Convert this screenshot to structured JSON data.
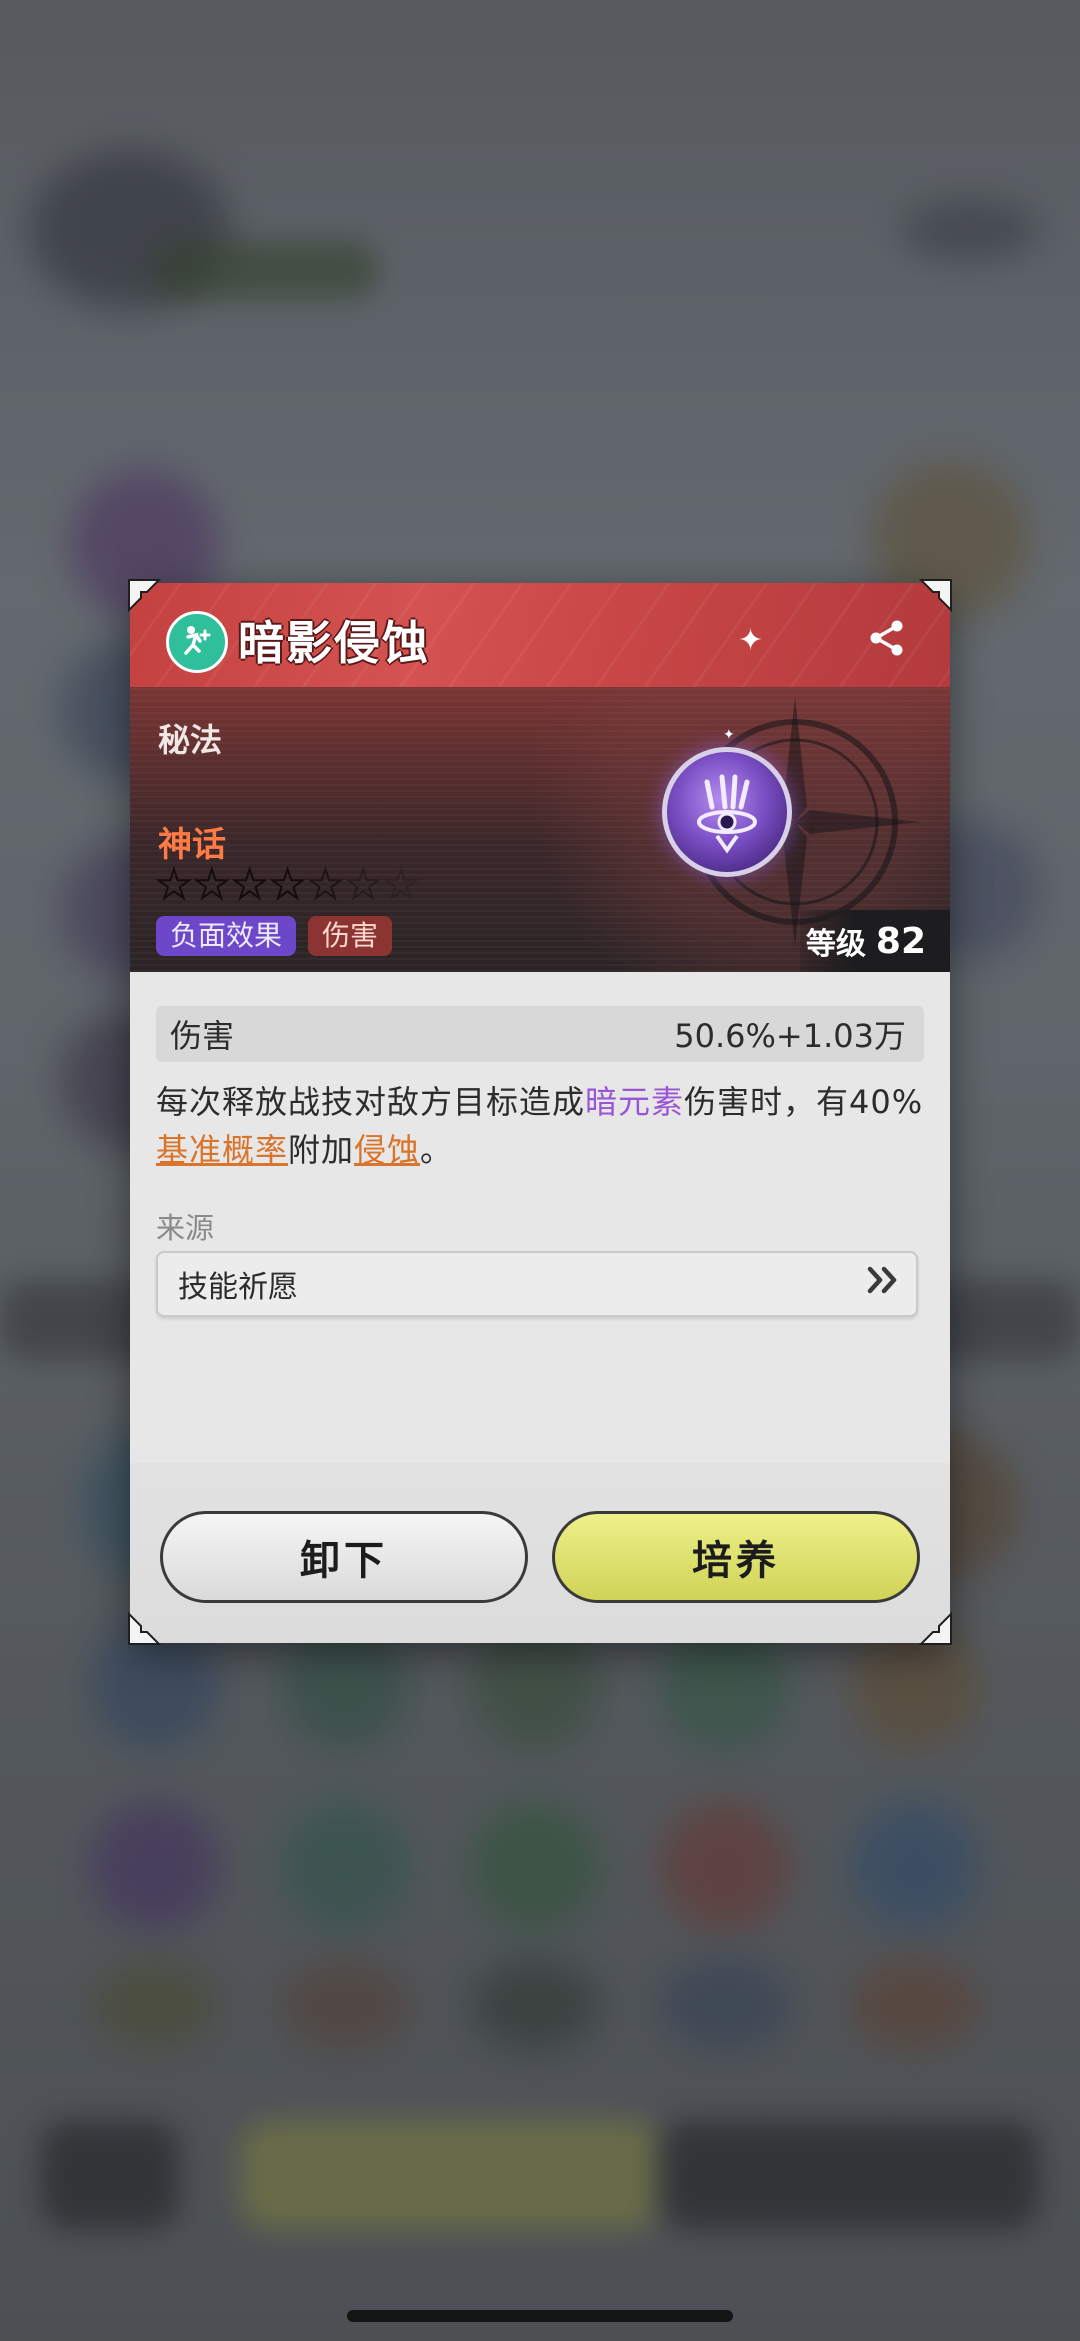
{
  "popup": {
    "title": "暗影侵蚀",
    "type_icon": "running-figure-icon",
    "category": "秘法",
    "rarity": "神话",
    "stars_total": 7,
    "stars_filled": 0,
    "tags": [
      "负面效果",
      "伤害"
    ],
    "level_label": "等级",
    "level_value": "82",
    "skill_icon": "dark-element-sigil-icon",
    "share_icon": "share-icon",
    "stat": {
      "label": "伤害",
      "value": "50.6%+1.03万"
    },
    "description": {
      "part1": "每次释放战技对敌方目标造成",
      "element": "暗元素",
      "part2": "伤害时，有40%",
      "link1": "基准概率",
      "part3": "附加",
      "link2": "侵蚀",
      "part4": "。"
    },
    "source_label": "来源",
    "source_value": "技能祈愿",
    "buttons": {
      "unequip": "卸下",
      "train": "培养"
    }
  },
  "colors": {
    "header_red": "#c84646",
    "rarity_orange": "#ff7b45",
    "tag_purple": "#6c47c8",
    "tag_red": "#8c3432",
    "highlight_purple": "#9a55d6",
    "highlight_orange": "#d9742a",
    "train_button": "#dfe271"
  }
}
